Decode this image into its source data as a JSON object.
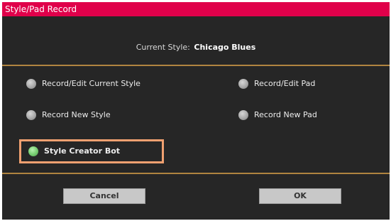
{
  "dialog": {
    "title": "Style/Pad Record",
    "current_style_label": "Current Style:",
    "current_style_value": "Chicago Blues",
    "options": [
      {
        "label": "Record/Edit Current Style",
        "selected": false
      },
      {
        "label": "Record/Edit Pad",
        "selected": false
      },
      {
        "label": "Record New Style",
        "selected": false
      },
      {
        "label": "Record New Pad",
        "selected": false
      },
      {
        "label": "Style Creator Bot",
        "selected": true
      }
    ],
    "cancel_label": "Cancel",
    "ok_label": "OK"
  },
  "colors": {
    "title_bar": "#e0004a",
    "background": "#262626",
    "separator": "#b08440",
    "highlight_border": "#f0a070",
    "radio_selected": "#7ad074",
    "radio_unselected": "#a8a8a8",
    "button_bg": "#c8c8c8"
  }
}
